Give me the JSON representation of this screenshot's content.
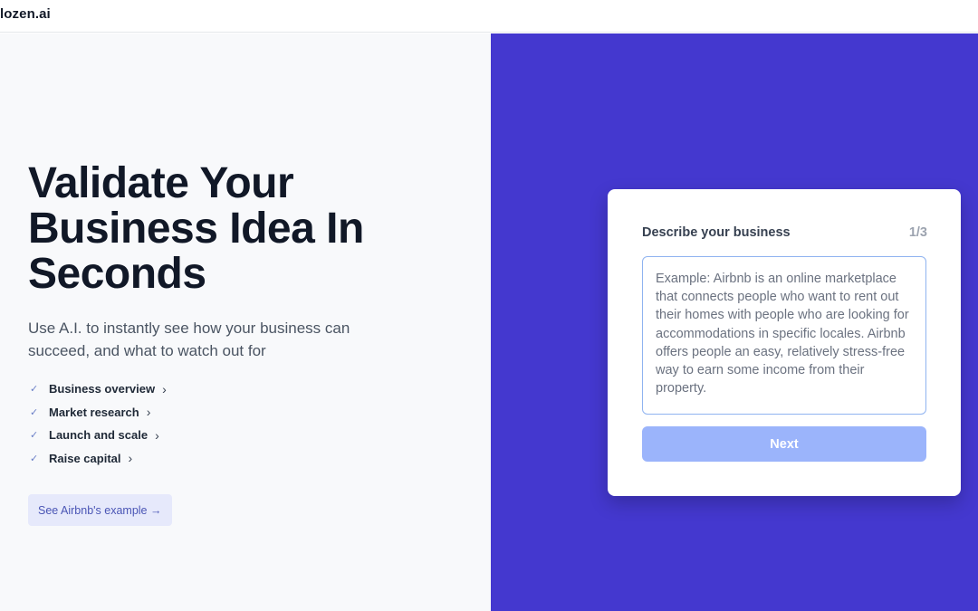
{
  "app": {
    "logo_text": "lozen.ai"
  },
  "hero": {
    "title": "Validate Your Business Idea In Seconds",
    "subtitle": "Use A.I. to instantly see how your business can succeed, and what to watch out for"
  },
  "features": [
    {
      "label": "Business overview",
      "icon": "check-icon"
    },
    {
      "label": "Market research",
      "icon": "check-icon"
    },
    {
      "label": "Launch and scale",
      "icon": "check-icon"
    },
    {
      "label": "Raise capital",
      "icon": "check-icon"
    }
  ],
  "symbols": {
    "check": "✓",
    "chevron": "›"
  },
  "example_button": {
    "label": "See Airbnb's example →"
  },
  "form": {
    "title": "Describe your business",
    "step": "1/3",
    "placeholder": "Example: Airbnb is an online marketplace that connects people who want to rent out their homes with people who are looking for accommodations in specific locales. Airbnb offers people an easy, relatively stress-free way to earn some income from their property.",
    "next_label": "Next"
  },
  "colors": {
    "panel_accent": "#4438cf",
    "next_button": "#9bb4fb",
    "example_button_bg": "#e6e9fb",
    "textarea_border": "#8fb3f0"
  }
}
